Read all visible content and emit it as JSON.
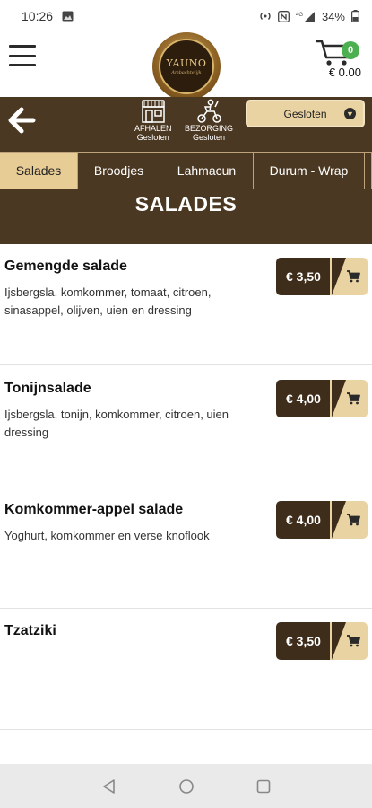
{
  "status_bar": {
    "time": "10:26",
    "battery": "34%",
    "network": "4G"
  },
  "header": {
    "logo_text": "YAUNO",
    "logo_sub": "Ambachtelijk",
    "cart_count": "0",
    "cart_total": "€ 0.00"
  },
  "delivery": {
    "pickup": {
      "title": "AFHALEN",
      "status": "Gesloten"
    },
    "delivery": {
      "title": "BEZORGING",
      "status": "Gesloten"
    },
    "select_value": "Gesloten"
  },
  "tabs": [
    {
      "label": "Salades"
    },
    {
      "label": "Broodjes"
    },
    {
      "label": "Lahmacun"
    },
    {
      "label": "Durum - Wrap"
    }
  ],
  "section_title": "SALADES",
  "items": [
    {
      "name": "Gemengde salade",
      "description": "Ijsbergsla, komkommer, tomaat, citroen, sinasappel, olijven, uien en dressing",
      "price": "€ 3,50"
    },
    {
      "name": "Tonijnsalade",
      "description": "Ijsbergsla, tonijn, komkommer, citroen, uien dressing",
      "price": "€ 4,00"
    },
    {
      "name": "Komkommer-appel salade",
      "description": "Yoghurt, komkommer en verse knoflook",
      "price": "€ 4,00"
    },
    {
      "name": "Tzatziki",
      "description": "",
      "price": "€ 3,50"
    }
  ],
  "colors": {
    "brand_brown": "#4b3822",
    "accent_tan": "#e8cc96",
    "cart_badge": "#4caf50"
  },
  "icons": {
    "menu": "hamburger-icon",
    "cart": "cart-icon",
    "back": "arrow-left-icon",
    "pickup": "store-icon",
    "delivery": "scooter-icon",
    "add": "cart-add-icon"
  }
}
